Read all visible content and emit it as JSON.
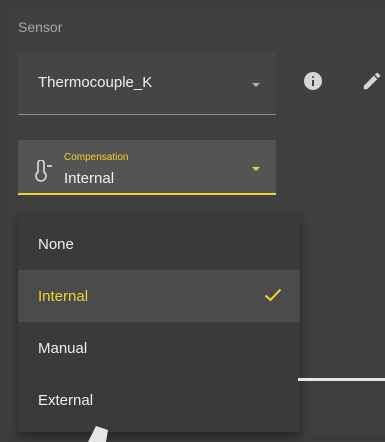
{
  "sensor": {
    "section_label": "Sensor",
    "selected_value": "Thermocouple_K"
  },
  "compensation": {
    "label": "Compensation",
    "value": "Internal",
    "accent_color": "#f2d22e"
  },
  "menu": {
    "items": [
      {
        "label": "None",
        "selected": false
      },
      {
        "label": "Internal",
        "selected": true
      },
      {
        "label": "Manual",
        "selected": false
      },
      {
        "label": "External",
        "selected": false
      }
    ]
  },
  "icons": {
    "info": "info-icon",
    "edit": "pencil-icon",
    "thermometer": "thermometer-icon",
    "check": "check-icon"
  }
}
